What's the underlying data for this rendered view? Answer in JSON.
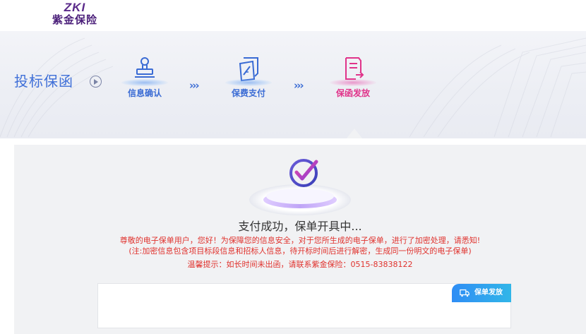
{
  "brand": {
    "logo_mark": "ZKI",
    "logo_text": "紫金保险"
  },
  "banner": {
    "title": "投标保函",
    "steps": [
      {
        "label": "信息确认",
        "icon": "stamp-icon",
        "state": "done"
      },
      {
        "label": "保费支付",
        "icon": "payment-document-icon",
        "state": "done"
      },
      {
        "label": "保函发放",
        "icon": "issue-document-icon",
        "state": "active"
      }
    ],
    "separator": "›››"
  },
  "status": {
    "headline": "支付成功，保单开具中...",
    "notice_line1": "尊敬的电子保单用户，您好！为保障您的信息安全，对于您所生成的电子保单，进行了加密处理，请悉知!",
    "notice_line2": "(注:加密信息包含项目标段信息和招标人信息，待开标时间后进行解密，生成同一份明文的电子保单)",
    "notice_line3": "温馨提示：如长时间未出函，请联系紫金保险：0515-83838122"
  },
  "doc_panel": {
    "button_label": "保单发放",
    "button_icon": "truck-icon"
  },
  "colors": {
    "step_done": "#3a6bd4",
    "step_active": "#e0338a",
    "notice_text": "#e0322d",
    "button_gradient_start": "#2f8df5",
    "button_gradient_end": "#31b6e8"
  }
}
